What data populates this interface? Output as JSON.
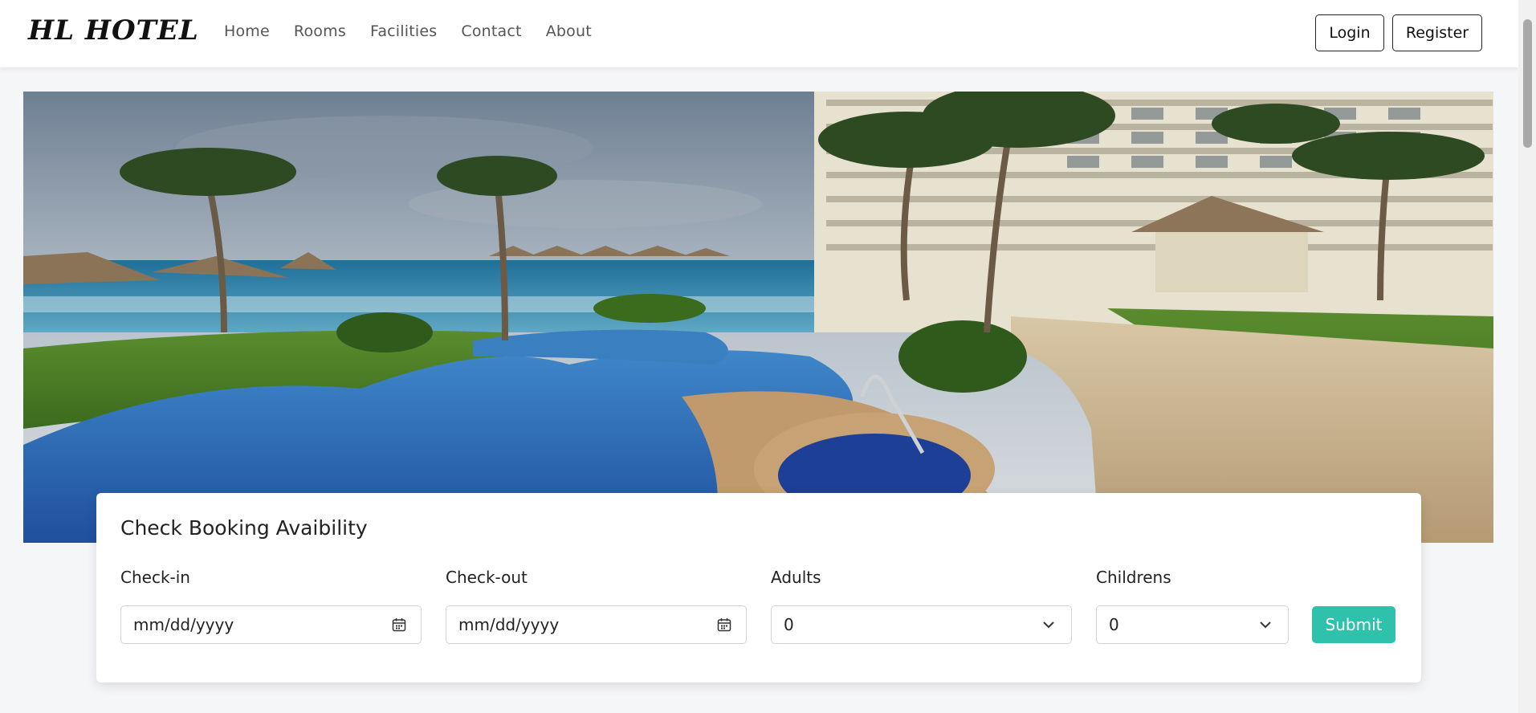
{
  "brand": "HL HOTEL",
  "nav": {
    "links": [
      "Home",
      "Rooms",
      "Facilities",
      "Contact",
      "About"
    ],
    "login_label": "Login",
    "register_label": "Register"
  },
  "hero": {
    "image_icon": "resort-pool-photo"
  },
  "booking": {
    "title": "Check Booking Avaibility",
    "checkin_label": "Check-in",
    "checkin_value": "mm/dd/yyyy",
    "checkout_label": "Check-out",
    "checkout_value": "mm/dd/yyyy",
    "adults_label": "Adults",
    "adults_value": "0",
    "children_label": "Childrens",
    "children_value": "0",
    "submit_label": "Submit"
  },
  "colors": {
    "accent": "#2ec1ac",
    "page_bg": "#f5f6f8"
  }
}
